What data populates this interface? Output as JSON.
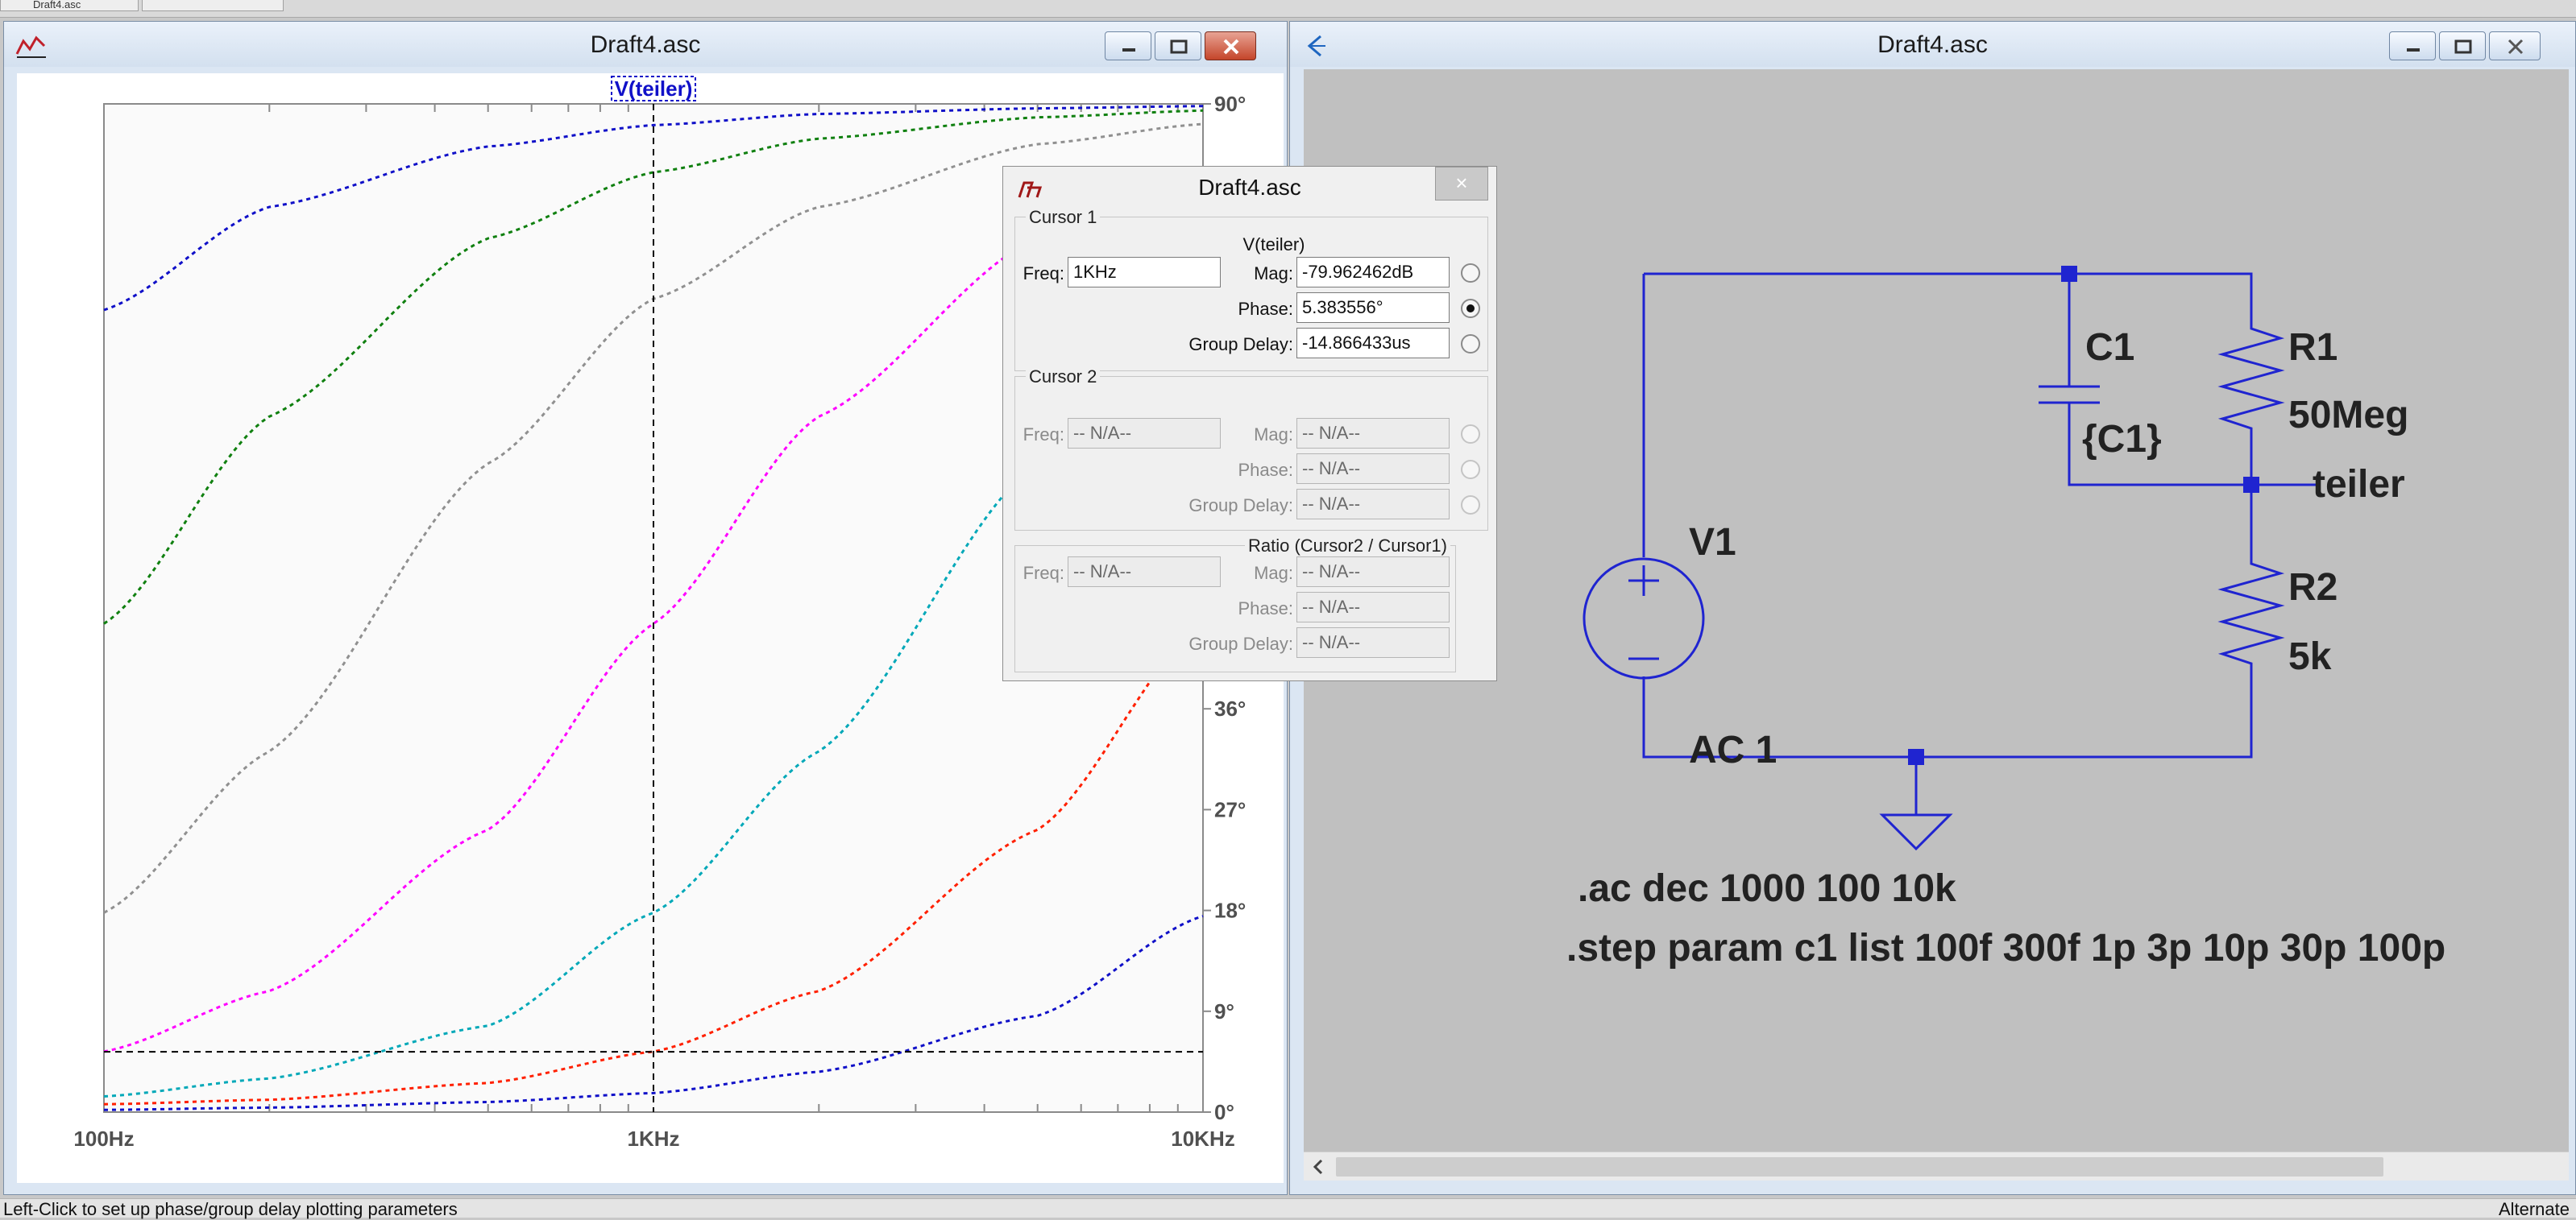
{
  "tabs": [
    {
      "label": "Draft4.asc"
    },
    {
      "label": ""
    }
  ],
  "waveform_window": {
    "title": "Draft4.asc",
    "trace_label": "V(teiler)",
    "icon": "waveform-app-icon"
  },
  "schematic_window": {
    "title": "Draft4.asc",
    "icon": "ltspice-schematic-icon",
    "components": {
      "c1_name": "C1",
      "c1_value": "{C1}",
      "r1_name": "R1",
      "r1_value": "50Meg",
      "net_label": "teiler",
      "v1_name": "V1",
      "v1_value": "AC 1",
      "r2_name": "R2",
      "r2_value": "5k"
    },
    "directives": [
      ".ac dec 1000 100 10k",
      ".step param c1 list 100f 300f 1p 3p 10p 30p 100p"
    ]
  },
  "cursor_dialog": {
    "title": "Draft4.asc",
    "close_glyph": "×",
    "cursor1": {
      "group_label": "Cursor 1",
      "trace": "V(teiler)",
      "freq_label": "Freq:",
      "freq_value": "1KHz",
      "mag_label": "Mag:",
      "mag_value": "-79.962462dB",
      "phase_label": "Phase:",
      "phase_value": "5.383556°",
      "gd_label": "Group Delay:",
      "gd_value": "-14.866433us",
      "selected": "phase"
    },
    "cursor2": {
      "group_label": "Cursor 2",
      "freq_label": "Freq:",
      "freq_value": "-- N/A--",
      "mag_label": "Mag:",
      "mag_value": "-- N/A--",
      "phase_label": "Phase:",
      "phase_value": "-- N/A--",
      "gd_label": "Group Delay:",
      "gd_value": "-- N/A--"
    },
    "ratio": {
      "group_label": "Ratio (Cursor2 / Cursor1)",
      "freq_label": "Freq:",
      "freq_value": "-- N/A--",
      "mag_label": "Mag:",
      "mag_value": "-- N/A--",
      "phase_label": "Phase:",
      "phase_value": "-- N/A--",
      "gd_label": "Group Delay:",
      "gd_value": "-- N/A--"
    }
  },
  "status_bar": {
    "left": "Left-Click to set up phase/group delay plotting parameters",
    "right": "Alternate"
  },
  "chart_data": {
    "type": "line",
    "title": "V(teiler)",
    "xscale": "log",
    "xlim": [
      100,
      10000
    ],
    "x_ticks": [
      "100Hz",
      "1KHz",
      "10KHz"
    ],
    "ylim": [
      0,
      90
    ],
    "y_ticks": [
      "0°",
      "9°",
      "18°",
      "27°",
      "36°",
      "90°"
    ],
    "grid": false,
    "line_style": "dotted",
    "series": [
      {
        "color": "#1010c8",
        "x": [
          100,
          200,
          500,
          1000,
          2000,
          5000,
          10000
        ],
        "y": [
          71.6,
          80.8,
          86.2,
          88.1,
          89.1,
          89.6,
          89.8
        ]
      },
      {
        "color": "#108010",
        "x": [
          100,
          200,
          500,
          1000,
          2000,
          5000,
          10000
        ],
        "y": [
          43.6,
          62.1,
          78.0,
          83.9,
          86.9,
          88.8,
          89.4
        ]
      },
      {
        "color": "#909090",
        "x": [
          100,
          200,
          500,
          1000,
          2000,
          5000,
          10000
        ],
        "y": [
          17.8,
          32.2,
          57.9,
          72.6,
          80.8,
          86.4,
          88.2
        ]
      },
      {
        "color": "#ff00ff",
        "x": [
          100,
          200,
          500,
          1000,
          2000,
          5000,
          10000
        ],
        "y": [
          5.4,
          10.8,
          25.2,
          43.6,
          62.1,
          78.0,
          83.9
        ]
      },
      {
        "color": "#00a8b8",
        "x": [
          100,
          200,
          500,
          1000,
          2000,
          5000,
          10000
        ],
        "y": [
          1.4,
          3.0,
          7.7,
          17.8,
          32.2,
          57.9,
          72.6
        ]
      },
      {
        "color": "#ff2000",
        "x": [
          100,
          200,
          500,
          1000,
          2000,
          5000,
          10000
        ],
        "y": [
          0.7,
          1.1,
          2.6,
          5.4,
          10.8,
          25.2,
          43.6
        ]
      },
      {
        "color": "#1010c8",
        "x": [
          100,
          200,
          500,
          1000,
          2000,
          5000,
          10000
        ],
        "y": [
          0.2,
          0.4,
          0.9,
          1.7,
          3.6,
          8.6,
          17.5
        ]
      }
    ],
    "cursor": {
      "x": 1000,
      "y": 5.383556
    }
  }
}
